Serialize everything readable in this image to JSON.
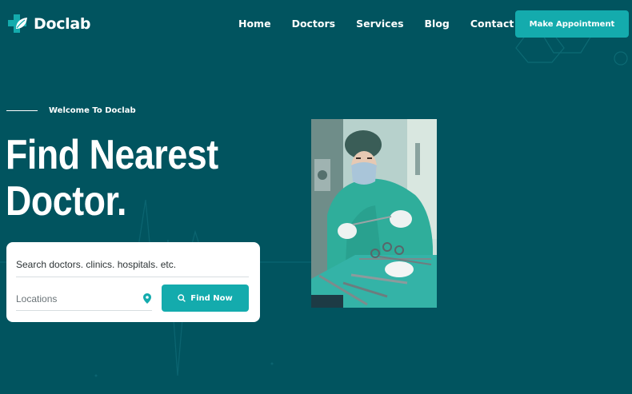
{
  "brand": {
    "name": "Doclab"
  },
  "nav": {
    "items": [
      {
        "label": "Home"
      },
      {
        "label": "Doctors"
      },
      {
        "label": "Services"
      },
      {
        "label": "Blog"
      },
      {
        "label": "Contact"
      }
    ],
    "cta_label": "Make Appointment"
  },
  "hero": {
    "eyebrow": "Welcome To Doclab",
    "title_line1": "Find Nearest",
    "title_line2": "Doctor."
  },
  "search": {
    "query_placeholder": "Search doctors. clinics. hospitals. etc.",
    "location_placeholder": "Locations",
    "button_label": "Find Now"
  },
  "colors": {
    "background": "#01545f",
    "accent": "#14abad",
    "card": "#ffffff"
  },
  "icons": [
    "logo-cross-leaf-icon",
    "location-pin-icon",
    "search-icon"
  ]
}
